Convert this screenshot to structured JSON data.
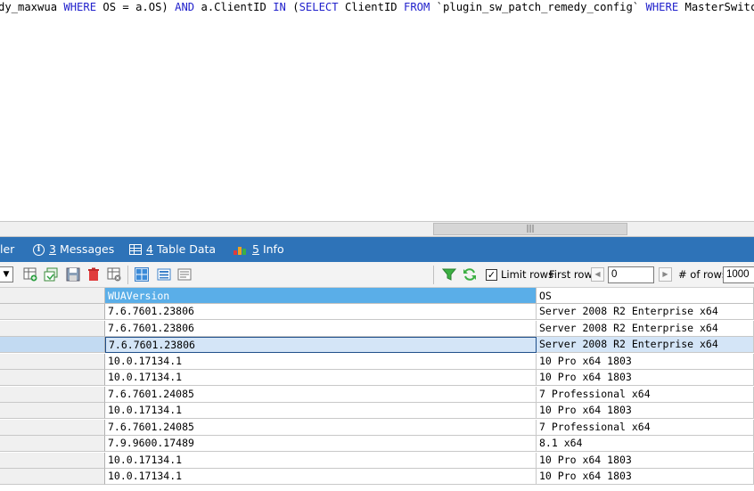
{
  "editor": {
    "sql_parts": [
      {
        "t": "dy_maxwua ",
        "kw": false
      },
      {
        "t": "WHERE",
        "kw": true
      },
      {
        "t": " OS = a.OS) ",
        "kw": false
      },
      {
        "t": "AND",
        "kw": true
      },
      {
        "t": " a.ClientID ",
        "kw": false
      },
      {
        "t": "IN",
        "kw": true
      },
      {
        "t": " (",
        "kw": false
      },
      {
        "t": "SELECT",
        "kw": true
      },
      {
        "t": " ClientID ",
        "kw": false
      },
      {
        "t": "FROM",
        "kw": true
      },
      {
        "t": " `plugin_sw_patch_remedy_config` ",
        "kw": false
      },
      {
        "t": "WHERE",
        "kw": true
      },
      {
        "t": " MasterSwitch",
        "kw": false
      }
    ]
  },
  "scrollbar": {
    "thumb_grip": "|||"
  },
  "tabs": {
    "partial": {
      "label": "ler"
    },
    "messages": {
      "num": "3",
      "label": "Messages",
      "icon": "info-icon"
    },
    "table_data": {
      "num": "4",
      "label": "Table Data",
      "icon": "table-icon"
    },
    "info": {
      "num": "5",
      "label": "Info",
      "icon": "chart-icon"
    }
  },
  "toolbar": {
    "limit_rows_label": "Limit rows",
    "limit_rows_checked": true,
    "first_row_label": "First row",
    "first_row_value": "0",
    "num_rows_label": "# of rows",
    "num_rows_value": "1000"
  },
  "grid": {
    "columns": [
      "",
      "WUAVersion",
      "OS"
    ],
    "rows": [
      {
        "wua": "7.6.7601.23806",
        "os": "Server 2008 R2 Enterprise x64"
      },
      {
        "wua": "7.6.7601.23806",
        "os": "Server 2008 R2 Enterprise x64"
      },
      {
        "wua": "7.6.7601.23806",
        "os": "Server 2008 R2 Enterprise x64",
        "selected": true
      },
      {
        "wua": "10.0.17134.1",
        "os": "10 Pro x64 1803"
      },
      {
        "wua": "10.0.17134.1",
        "os": "10 Pro x64 1803"
      },
      {
        "wua": "7.6.7601.24085",
        "os": "7 Professional  x64"
      },
      {
        "wua": "10.0.17134.1",
        "os": "10 Pro x64 1803"
      },
      {
        "wua": "7.6.7601.24085",
        "os": "7 Professional  x64"
      },
      {
        "wua": "7.9.9600.17489",
        "os": "8.1 x64"
      },
      {
        "wua": "10.0.17134.1",
        "os": "10 Pro x64 1803"
      },
      {
        "wua": "10.0.17134.1",
        "os": "10 Pro x64 1803"
      }
    ]
  },
  "colors": {
    "tab_bar": "#2e73b8",
    "keyword": "#2222cc",
    "header_bg": "#5aaee8"
  }
}
